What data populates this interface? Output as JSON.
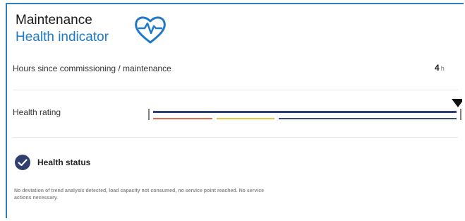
{
  "header": {
    "title": "Maintenance",
    "subtitle": "Health indicator",
    "icon": "heart-pulse-icon",
    "accent_color": "#1e7ac8"
  },
  "hours": {
    "label": "Hours since commissioning / maintenance",
    "value": "4",
    "unit": "h"
  },
  "health_rating": {
    "label": "Health rating",
    "level": 1.0,
    "bar_color": "#2f3f6f",
    "zone_colors": [
      "#e06a4a",
      "#f0c040",
      "#3a4a7a"
    ]
  },
  "health_status": {
    "icon": "check-circle-icon",
    "label": "Health status",
    "description": "No deviation of trend analysis detected, load capacity not consumed, no service point reached. No service actions necessary.",
    "icon_color": "#2f3f6f"
  }
}
